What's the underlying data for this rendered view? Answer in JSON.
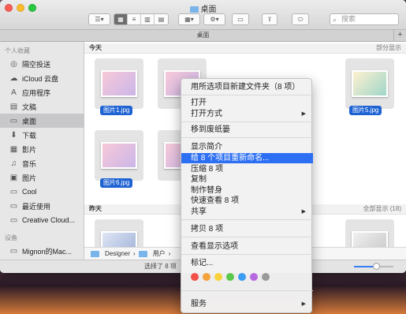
{
  "window": {
    "title": "桌面",
    "tab_title": "桌面",
    "tab_add": "+"
  },
  "toolbar": {
    "search_placeholder": "搜索"
  },
  "sidebar": {
    "favorites_header": "个人收藏",
    "items": [
      {
        "label": "隔空投送",
        "icon": "airdrop-icon"
      },
      {
        "label": "iCloud 云盘",
        "icon": "cloud-icon"
      },
      {
        "label": "应用程序",
        "icon": "applications-icon"
      },
      {
        "label": "文稿",
        "icon": "documents-icon"
      },
      {
        "label": "桌面",
        "icon": "desktop-icon"
      },
      {
        "label": "下载",
        "icon": "download-icon"
      },
      {
        "label": "影片",
        "icon": "movies-icon"
      },
      {
        "label": "音乐",
        "icon": "music-icon"
      },
      {
        "label": "图片",
        "icon": "pictures-icon"
      },
      {
        "label": "Cool",
        "icon": "folder-icon"
      },
      {
        "label": "最近使用",
        "icon": "recents-icon"
      },
      {
        "label": "Creative Cloud...",
        "icon": "folder-icon"
      }
    ],
    "devices_header": "设备",
    "device": {
      "label": "Mignon的Mac...",
      "icon": "computer-icon"
    }
  },
  "content": {
    "today": {
      "title": "今天",
      "action": "部分显示"
    },
    "files_today": [
      "图片1.jpg",
      "图片5.jpg",
      "图片6.jpg"
    ],
    "yesterday": {
      "title": "昨天",
      "action": "全部显示 (18)"
    }
  },
  "pathbar": [
    "Designer",
    "用户"
  ],
  "status": {
    "text": "选择了 8 项",
    "zoom_fraction": 0.55
  },
  "menu": {
    "items": [
      {
        "label": "用所选项目新建文件夹（8 项）"
      },
      {
        "label": "打开"
      },
      {
        "label": "打开方式",
        "submenu": true
      },
      {
        "label": "移到废纸篓"
      },
      {
        "label": "显示简介"
      },
      {
        "label": "给 8 个项目重新命名...",
        "highlighted": true
      },
      {
        "label": "压缩 8 项"
      },
      {
        "label": "复制"
      },
      {
        "label": "制作替身"
      },
      {
        "label": "快速查看 8 项"
      },
      {
        "label": "共享",
        "submenu": true
      },
      {
        "label": "拷贝 8 项"
      },
      {
        "label": "查看显示选项"
      },
      {
        "label": "标记..."
      },
      {
        "label": "服务",
        "submenu": true
      }
    ],
    "tag_colors": [
      "#f2514a",
      "#f4a23a",
      "#f7d23a",
      "#5ac84a",
      "#3b9bf5",
      "#b768e0",
      "#9a9a9a"
    ]
  }
}
